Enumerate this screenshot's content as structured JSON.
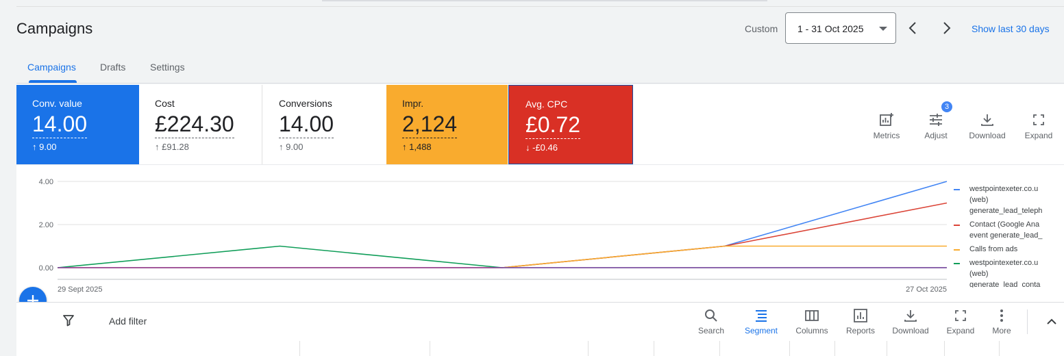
{
  "header": {
    "title": "Campaigns",
    "date_preset": "Custom",
    "date_range": "1 - 31 Oct 2025",
    "show_last": "Show last 30 days"
  },
  "tabs": [
    {
      "label": "Campaigns",
      "active": true
    },
    {
      "label": "Drafts",
      "active": false
    },
    {
      "label": "Settings",
      "active": false
    }
  ],
  "scorecards": [
    {
      "label": "Conv. value",
      "value": "14.00",
      "delta": "9.00",
      "delta_dir": "up",
      "color": "#1a73e8"
    },
    {
      "label": "Cost",
      "value": "£224.30",
      "delta": "£91.28",
      "delta_dir": "up",
      "color": "#ffffff"
    },
    {
      "label": "Conversions",
      "value": "14.00",
      "delta": "9.00",
      "delta_dir": "up",
      "color": "#ffffff"
    },
    {
      "label": "Impr.",
      "value": "2,124",
      "delta": "1,488",
      "delta_dir": "up",
      "color": "#f9ab2e"
    },
    {
      "label": "Avg. CPC",
      "value": "£0.72",
      "delta": "-£0.46",
      "delta_dir": "down",
      "color": "#d93025"
    }
  ],
  "chart_tools": [
    {
      "label": "Metrics",
      "icon": "metrics-icon"
    },
    {
      "label": "Adjust",
      "icon": "adjust-icon",
      "badge": "3"
    },
    {
      "label": "Download",
      "icon": "download-icon"
    },
    {
      "label": "Expand",
      "icon": "expand-icon"
    }
  ],
  "chart_data": {
    "type": "line",
    "x": [
      "29 Sept 2025",
      "6 Oct 2025",
      "13 Oct 2025",
      "20 Oct 2025",
      "27 Oct 2025"
    ],
    "x_tick_labels": [
      "29 Sept 2025",
      "27 Oct 2025"
    ],
    "y_tick_labels": [
      "4.00",
      "2.00",
      "0.00"
    ],
    "ylim": [
      0,
      4
    ],
    "grid": true,
    "legend_position": "right",
    "series": [
      {
        "name": "westpointexeter.co.u (web) generate_lead_teleph",
        "color": "#4285f4",
        "values": [
          0,
          0,
          0,
          1,
          4
        ]
      },
      {
        "name": "Contact (Google Ana event generate_lead_",
        "color": "#db4437",
        "values": [
          0,
          0,
          0,
          1,
          3
        ]
      },
      {
        "name": "Calls from ads",
        "color": "#f9ab2e",
        "values": [
          0,
          0,
          0,
          1,
          1
        ]
      },
      {
        "name": "westpointexeter.co.u (web) generate_lead_conta",
        "color": "#0f9d58",
        "values": [
          0,
          1,
          0,
          0,
          0
        ]
      },
      {
        "name": "",
        "color": "#8e44ad",
        "values": [
          0,
          0,
          0,
          0,
          0
        ]
      }
    ]
  },
  "filter_bar": {
    "add_filter": "Add filter",
    "tools": [
      {
        "label": "Search",
        "icon": "search-icon"
      },
      {
        "label": "Segment",
        "icon": "segment-icon",
        "active": true
      },
      {
        "label": "Columns",
        "icon": "columns-icon"
      },
      {
        "label": "Reports",
        "icon": "reports-icon"
      },
      {
        "label": "Download",
        "icon": "download-icon"
      },
      {
        "label": "Expand",
        "icon": "expand-icon"
      },
      {
        "label": "More",
        "icon": "more-vert-icon"
      }
    ]
  }
}
